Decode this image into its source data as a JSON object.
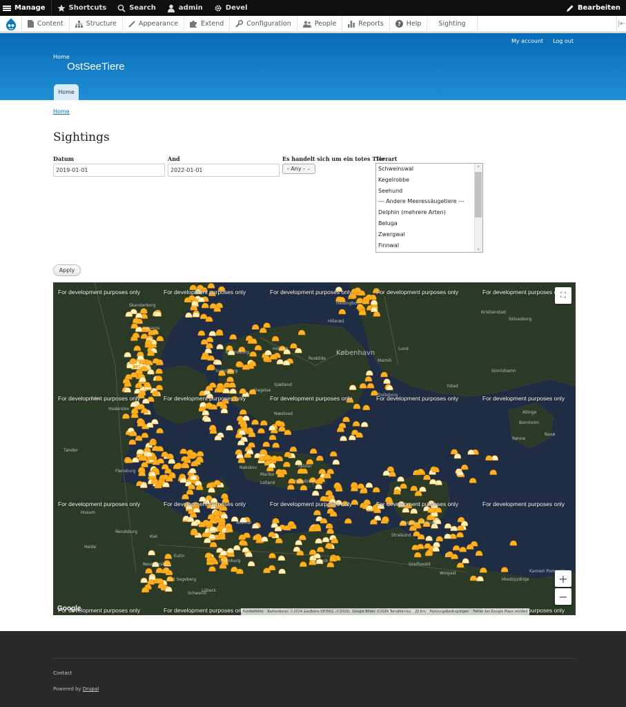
{
  "toolbar": {
    "manage": "Manage",
    "shortcuts": "Shortcuts",
    "search": "Search",
    "user": "admin",
    "devel": "Devel",
    "edit": "Bearbeiten"
  },
  "tray": {
    "items": [
      "Content",
      "Structure",
      "Appearance",
      "Extend",
      "Configuration",
      "People",
      "Reports",
      "Help",
      "Sighting"
    ]
  },
  "header": {
    "my_account": "My account",
    "log_out": "Log out",
    "home_link": "Home",
    "site_name": "OstSeeTiere",
    "primary_tab": "Home"
  },
  "breadcrumb": "Home",
  "page_title": "Sightings",
  "filters": {
    "datum_label": "Datum",
    "datum_value": "2019-01-01",
    "and_label": "And",
    "and_value": "2022-01-01",
    "dead_label": "Es handelt sich um ein totes Tier",
    "dead_value": "- Any -",
    "tierart_label": "Tierart",
    "tierart_options": [
      "Schweinswal",
      "Kegelrobbe",
      "Seehund",
      "--- Andere Meeressäugetiere ---",
      "Delphin (mehrere Arten)",
      "Beluga",
      "Zwergwal",
      "Finnwal"
    ]
  },
  "apply_label": "Apply",
  "map": {
    "dev_text": "For development purposes only",
    "places": [
      "Skanderborg",
      "Horsens",
      "Kalundborg",
      "Holbæk",
      "Roskilde",
      "København",
      "Malmö",
      "Lund",
      "Helsingborg",
      "Hillerød",
      "Sjælland",
      "Slagelse",
      "Næstved",
      "Ystad",
      "Trelleborg",
      "Bornholm",
      "Rønne",
      "Nexø",
      "Nakskov",
      "Maribo",
      "Falster",
      "Lolland",
      "Nykøbing",
      "Rostock",
      "Stralsund",
      "Bergen auf Rügen",
      "Greifswald",
      "Wolgast",
      "Lübeck",
      "Kiel",
      "Rendsburg",
      "Neumünster",
      "Flensburg",
      "Husum",
      "Heide",
      "Oldenburg",
      "Wismar",
      "Schwerin",
      "Eutin",
      "Bad Segeberg",
      "Kamień Pomorski",
      "Svendborg",
      "Tønder",
      "Haderslev",
      "Ribe",
      "Kristianstad",
      "Sölvesborg",
      "Simrishamn",
      "Allinge",
      "Miedzyzdroje"
    ],
    "attribution": [
      "Kurzbefehle",
      "Kartendaten ©2024 GeoBasis-DE/BKG (©2009), Google Bilder ©2024 TerraMetrics",
      "20 km",
      "Nutzungsbedingungen",
      "Fehler bei Google Maps melden"
    ],
    "google": "Google",
    "zoom_in": "+",
    "zoom_out": "−",
    "fullscreen": "⛶"
  },
  "footer": {
    "contact": "Contact",
    "powered_prefix": "Powered by ",
    "powered_link": "Drupal"
  }
}
